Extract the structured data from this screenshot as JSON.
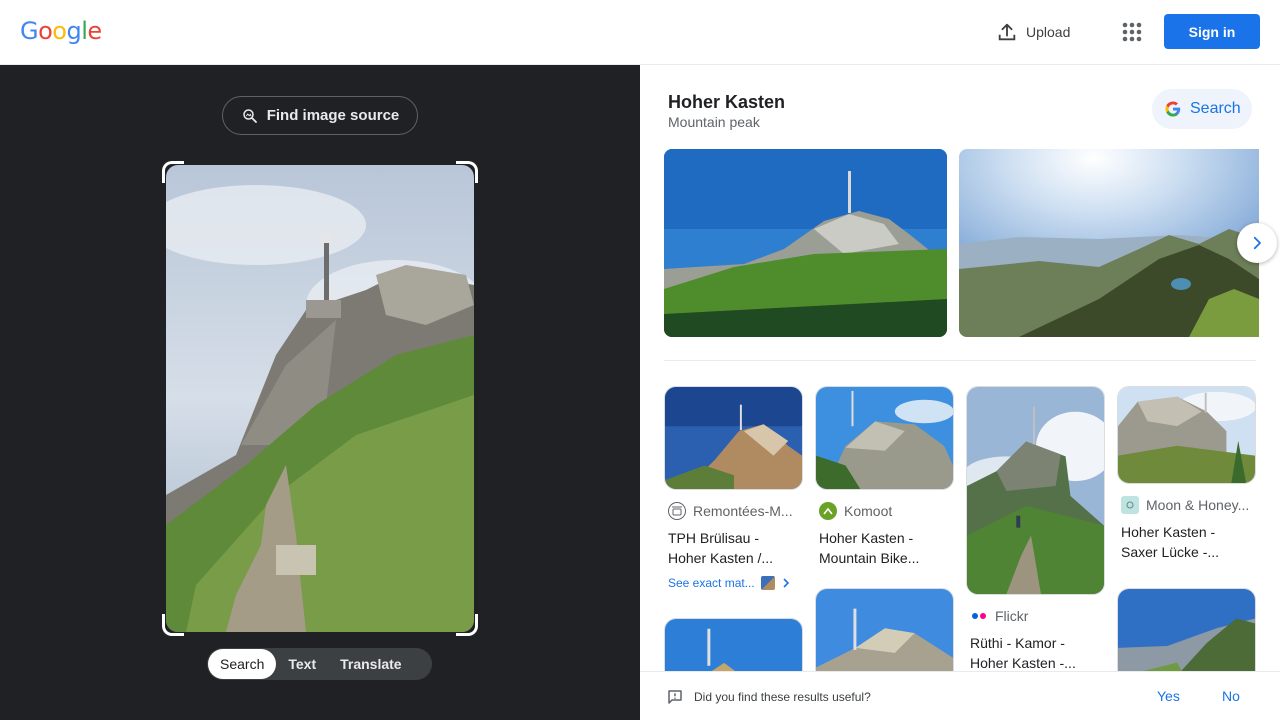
{
  "header": {
    "logo_letters": [
      {
        "ch": "G",
        "color": "#4285F4"
      },
      {
        "ch": "o",
        "color": "#EA4335"
      },
      {
        "ch": "o",
        "color": "#FBBC05"
      },
      {
        "ch": "g",
        "color": "#4285F4"
      },
      {
        "ch": "l",
        "color": "#34A853"
      },
      {
        "ch": "e",
        "color": "#EA4335"
      }
    ],
    "upload_label": "Upload",
    "upload_icon": "upload-icon",
    "apps_icon": "apps-grid-icon",
    "signin_label": "Sign in"
  },
  "left": {
    "find_source_label": "Find image source",
    "tabs": [
      {
        "label": "Search",
        "active": true
      },
      {
        "label": "Text",
        "active": false
      },
      {
        "label": "Translate",
        "active": false
      }
    ]
  },
  "right": {
    "entity_title": "Hoher Kasten",
    "entity_subtitle": "Mountain peak",
    "search_label": "Search",
    "results": [
      {
        "source": "Remontées-M...",
        "title_line1": "TPH Brülisau -",
        "title_line2": "Hoher Kasten /...",
        "exact_label": "See exact mat..."
      },
      {
        "source": "Komoot",
        "title_line1": "Hoher Kasten -",
        "title_line2": "Mountain Bike..."
      },
      {
        "source": "Flickr",
        "title_line1": "Rüthi - Kamor -",
        "title_line2": "Hoher Kasten -..."
      },
      {
        "source": "Moon & Honey...",
        "title_line1": "Hoher Kasten -",
        "title_line2": "Saxer Lücke -..."
      }
    ],
    "feedback": {
      "question": "Did you find these results useful?",
      "yes": "Yes",
      "no": "No"
    },
    "colors": {
      "accent": "#1a73e8",
      "dark_bg": "#202124"
    }
  }
}
